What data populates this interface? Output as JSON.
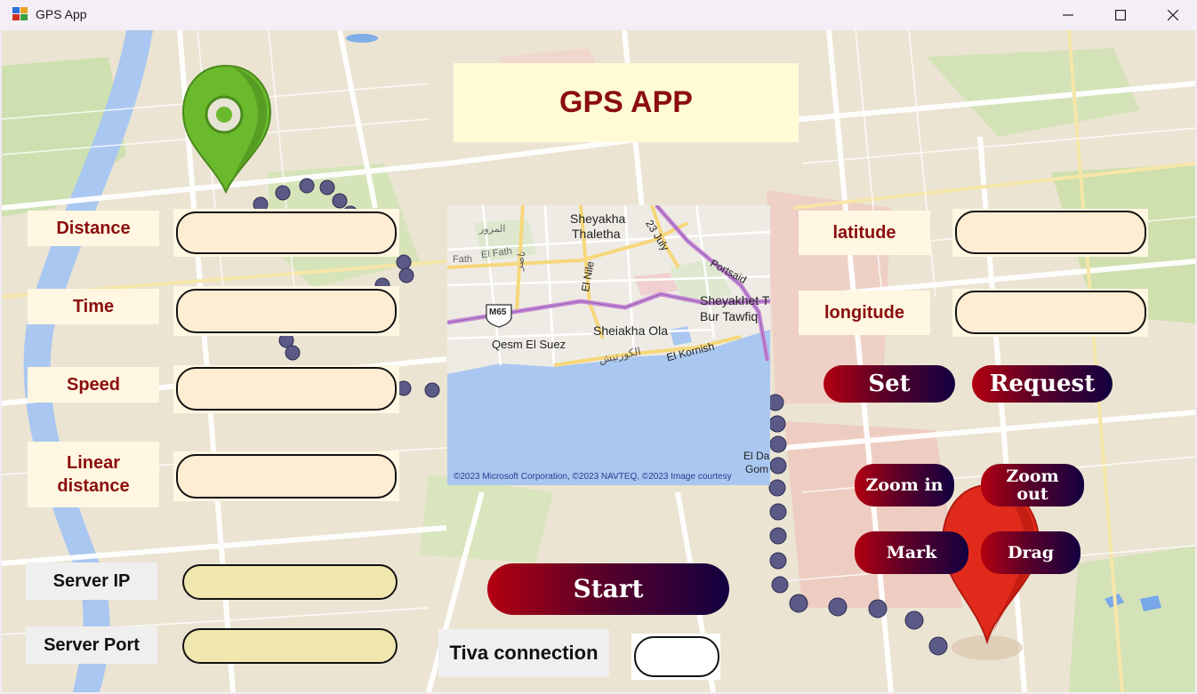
{
  "window": {
    "title": "GPS App",
    "minimize_glyph": "—",
    "maximize_glyph": "☐",
    "close_glyph": "✕"
  },
  "header": {
    "title": "GPS APP"
  },
  "left_panel": {
    "distance_label": "Distance",
    "time_label": "Time",
    "speed_label": "Speed",
    "linear_distance_label_1": "Linear",
    "linear_distance_label_2": "distance",
    "server_ip_label": "Server IP",
    "server_port_label": "Server Port",
    "distance_value": "",
    "time_value": "",
    "speed_value": "",
    "linear_distance_value": "",
    "server_ip_value": "",
    "server_port_value": ""
  },
  "right_panel": {
    "latitude_label": "latitude",
    "longitude_label": "longitude",
    "latitude_value": "",
    "longitude_value": "",
    "set_button": "Set",
    "request_button": "Request",
    "zoom_in_button": "Zoom in",
    "zoom_out_button_1": "Zoom",
    "zoom_out_button_2": "out",
    "mark_button": "Mark",
    "drag_button": "Drag"
  },
  "bottom": {
    "start_button": "Start",
    "tiva_label": "Tiva connection",
    "tiva_value": ""
  },
  "map": {
    "labels": {
      "sheyakha_1": "Sheyakha",
      "sheyakha_2": "Thaletha",
      "road_23july": "23 July",
      "portsaid": "Portsaid",
      "elfath": "Fath",
      "elfath2": "El Fath",
      "elnile": "El Nile",
      "m65": "M65",
      "sheyakhet_1": "Sheyakhet T",
      "sheyakhet_2": "Bur Tawfiq",
      "sheiakha_ola": "Sheiakha Ola",
      "qesm": "Qesm El Suez",
      "elkornish": "El Kornish",
      "elda": "El Da",
      "gom": "Gom",
      "arabic_1": "المرور",
      "arabic_2": "ناصر",
      "arabic_3": "الكورنيش"
    },
    "copyright": "©2023 Microsoft Corporation, ©2023 NAVTEQ, ©2023 Image courtesy"
  },
  "colors": {
    "label_text": "#8b0d0d",
    "label_bg": "#fff7e1",
    "field_bg": "#ffedd3",
    "server_field_bg": "#efe7ad",
    "water": "#a9c7f0",
    "pin_green": "#6bb92d",
    "pin_red": "#e02a1b"
  }
}
